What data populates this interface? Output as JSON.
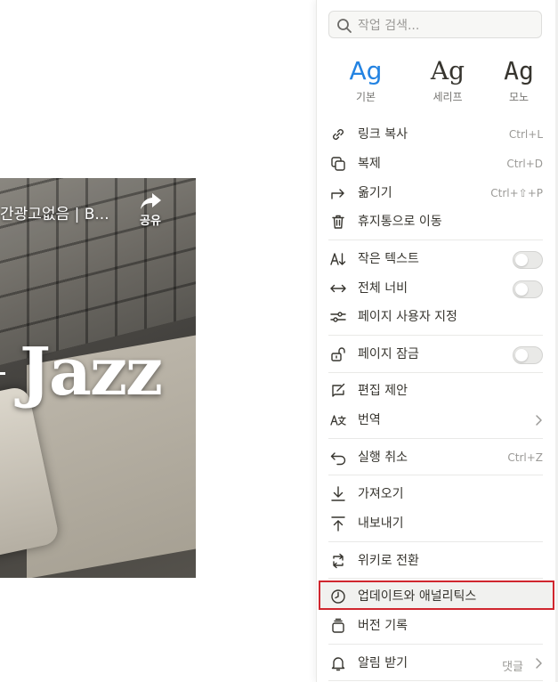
{
  "video": {
    "title": "간광고없음 | B...",
    "share_label": "공유",
    "overlay_text": "Jazz"
  },
  "menu": {
    "search_placeholder": "작업 검색...",
    "fonts": [
      {
        "sample": "Ag",
        "label": "기본",
        "active": true
      },
      {
        "sample": "Ag",
        "label": "세리프",
        "active": false
      },
      {
        "sample": "Ag",
        "label": "모노",
        "active": false
      }
    ],
    "items": {
      "copy_link": {
        "label": "링크 복사",
        "shortcut": "Ctrl+L",
        "icon": "link-icon"
      },
      "duplicate": {
        "label": "복제",
        "shortcut": "Ctrl+D",
        "icon": "duplicate-icon"
      },
      "move": {
        "label": "옮기기",
        "shortcut": "Ctrl+⇧+P",
        "icon": "move-arrow-icon"
      },
      "trash": {
        "label": "휴지통으로 이동",
        "icon": "trash-icon"
      },
      "small_text": {
        "label": "작은 텍스트",
        "icon": "small-text-icon",
        "toggle": false
      },
      "full_width": {
        "label": "전체 너비",
        "icon": "full-width-icon",
        "toggle": false
      },
      "customize": {
        "label": "페이지 사용자 지정",
        "icon": "sliders-icon"
      },
      "lock": {
        "label": "페이지 잠금",
        "icon": "unlock-icon",
        "toggle": false
      },
      "suggest": {
        "label": "편집 제안",
        "icon": "suggest-edit-icon"
      },
      "translate": {
        "label": "번역",
        "icon": "translate-icon"
      },
      "undo": {
        "label": "실행 취소",
        "shortcut": "Ctrl+Z",
        "icon": "undo-icon"
      },
      "import": {
        "label": "가져오기",
        "icon": "import-icon"
      },
      "export": {
        "label": "내보내기",
        "icon": "export-icon"
      },
      "wiki": {
        "label": "위키로 전환",
        "icon": "wiki-convert-icon"
      },
      "updates": {
        "label": "업데이트와 애널리틱스",
        "icon": "clock-icon"
      },
      "history": {
        "label": "버전 기록",
        "icon": "history-icon"
      },
      "notify": {
        "label": "알림 받기",
        "extra": "댓글",
        "icon": "bell-icon"
      }
    },
    "highlight_color": "#d0262e",
    "accent_color": "#2383e2"
  }
}
